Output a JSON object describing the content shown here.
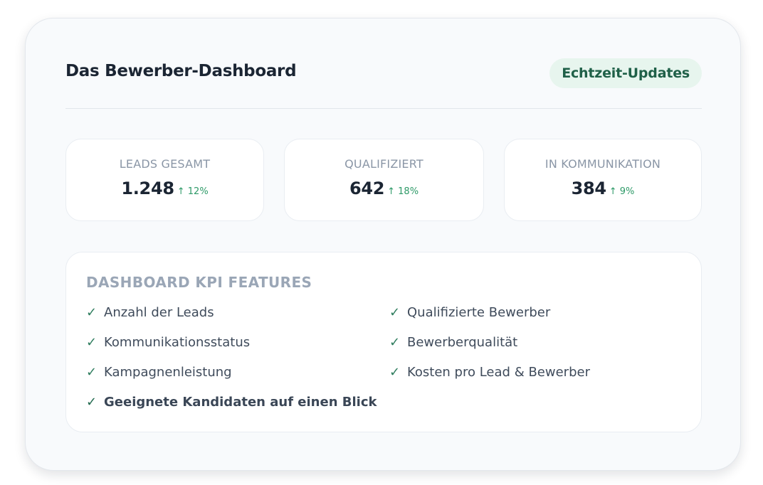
{
  "header": {
    "title": "Das Bewerber-Dashboard",
    "badge": "Echtzeit-Updates"
  },
  "stats": [
    {
      "label": "LEADS GESAMT",
      "value": "1.248",
      "trend": "↑ 12%"
    },
    {
      "label": "QUALIFIZIERT",
      "value": "642",
      "trend": "↑ 18%"
    },
    {
      "label": "IN KOMMUNIKATION",
      "value": "384",
      "trend": "↑ 9%"
    }
  ],
  "features": {
    "title": "DASHBOARD KPI FEATURES",
    "check_glyph": "✓",
    "items": [
      "Anzahl der Leads",
      "Qualifizierte Bewerber",
      "Kommunikationsstatus",
      "Bewerberqualität",
      "Kampagnenleistung",
      "Kosten pro Lead & Bewerber",
      "Geeignete Kandidaten auf einen Blick"
    ]
  },
  "colors": {
    "card_background": "#f8fafc",
    "badge_background": "#e7f5ee",
    "badge_text": "#1f6048",
    "trend_up": "#2e9a68",
    "check": "#2f7d5e",
    "heading": "#1b2533",
    "muted": "#8a96a6"
  }
}
